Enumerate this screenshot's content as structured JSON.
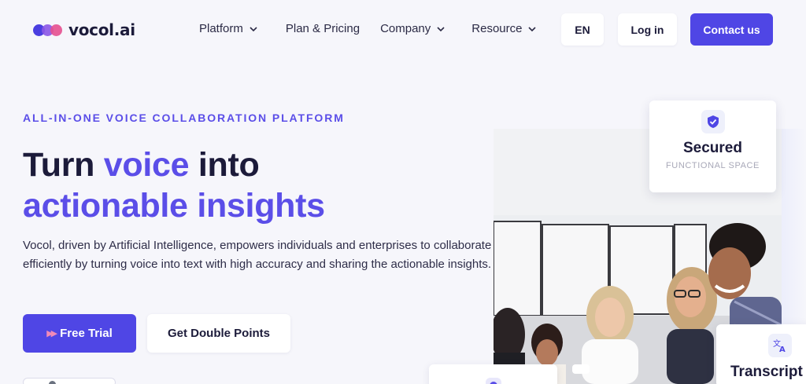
{
  "brand": {
    "name": "vocol.ai"
  },
  "nav": {
    "items": [
      {
        "label": "Platform",
        "has_dropdown": true
      },
      {
        "label": "Plan & Pricing",
        "has_dropdown": false
      },
      {
        "label": "Company",
        "has_dropdown": true
      },
      {
        "label": "Resource",
        "has_dropdown": true
      }
    ],
    "lang_label": "EN",
    "login_label": "Log in",
    "contact_label": "Contact us"
  },
  "hero": {
    "eyebrow": "ALL-IN-ONE VOICE COLLABORATION PLATFORM",
    "headline_part1": "Turn ",
    "headline_accent1": "voice",
    "headline_part2": " into",
    "headline_accent2": "actionable insights",
    "description": "Vocol, driven by Artificial Intelligence, empowers individuals and enterprises to collaborate efficiently by turning voice into text with high accuracy and sharing the actionable insights.",
    "primary_button": "Free Trial",
    "secondary_button": "Get Double Points"
  },
  "cards": {
    "secured": {
      "title": "Secured",
      "subtitle": "FUNCTIONAL SPACE",
      "icon": "shield-check-icon"
    },
    "transcript": {
      "title": "Transcript",
      "icon": "translate-icon"
    }
  },
  "colors": {
    "accent": "#5b4ee8",
    "primary_button": "#4f46e5",
    "background": "#f6f6fb",
    "text": "#1c1b3a"
  }
}
